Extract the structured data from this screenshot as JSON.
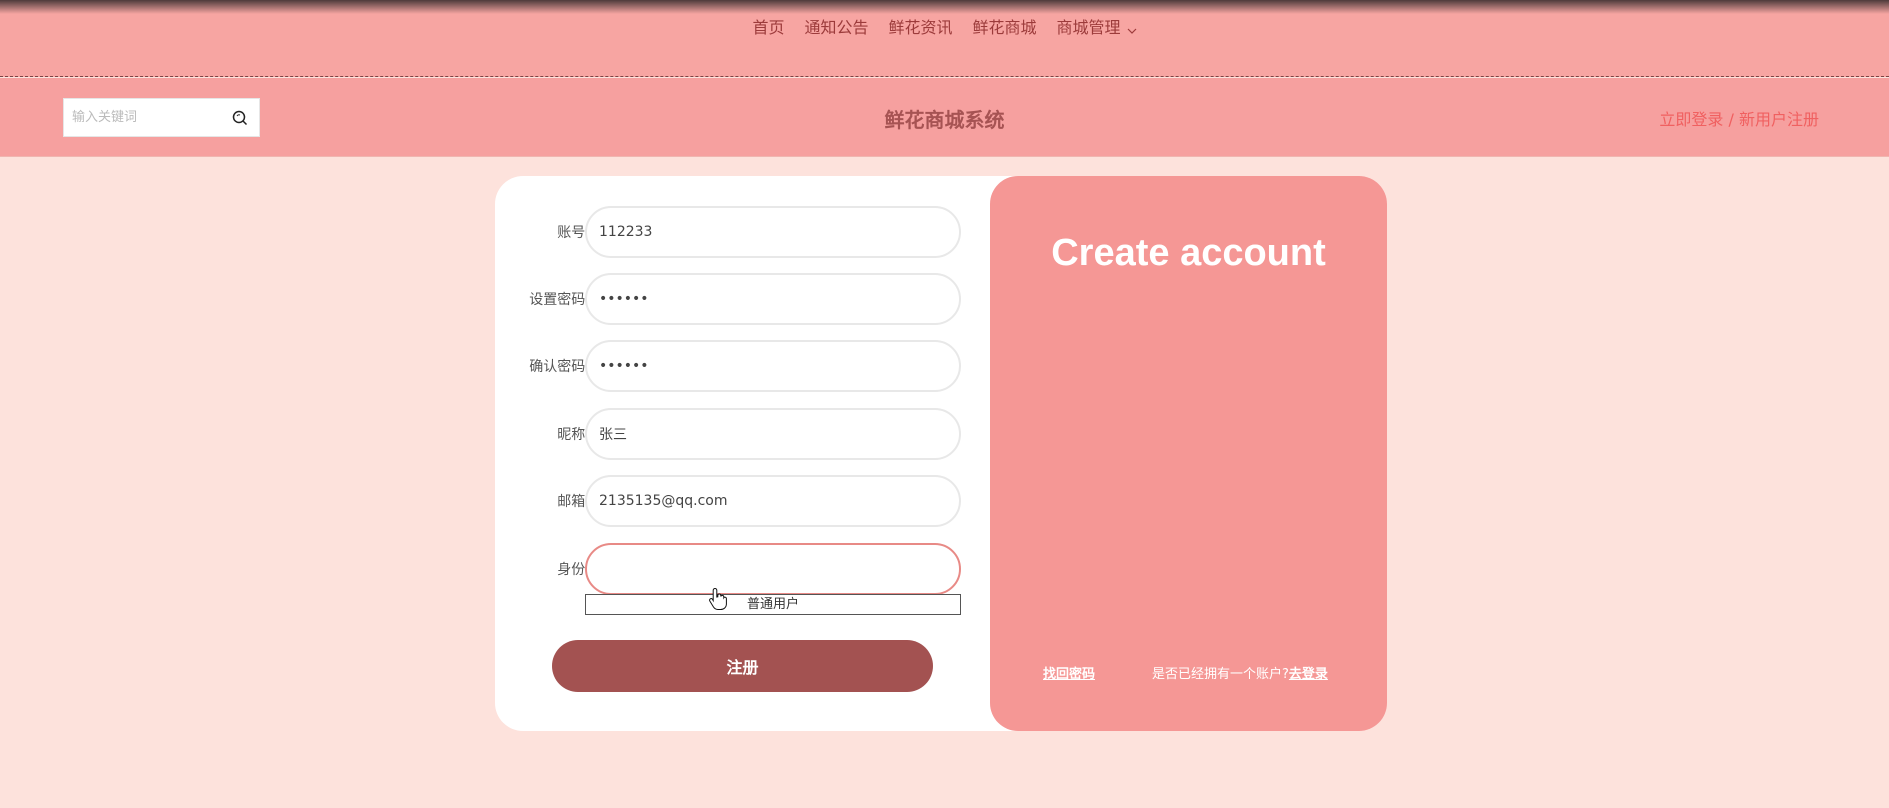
{
  "nav": {
    "items": [
      "首页",
      "通知公告",
      "鲜花资讯",
      "鲜花商城",
      "商城管理"
    ]
  },
  "header": {
    "search_placeholder": "输入关键词",
    "site_title": "鲜花商城系统",
    "login": "立即登录 /",
    "register": "新用户注册"
  },
  "form": {
    "account_label": "账号:",
    "account_value": "112233",
    "password_label": "设置密码:",
    "password_value": "••••••",
    "confirm_label": "确认密码:",
    "confirm_value": "••••••",
    "nickname_label": "昵称:",
    "nickname_value": "张三",
    "email_label": "邮箱:",
    "email_value": "2135135@qq.com",
    "role_label": "身份:",
    "role_value": "",
    "role_option": "普通用户",
    "submit_label": "注册"
  },
  "panel": {
    "title": "Create account",
    "forgot": "找回密码",
    "have_account": "是否已经拥有一个账户?",
    "go_login": "去登录"
  },
  "colors": {
    "topbar": "#f7a5a2",
    "header": "#f6a09f",
    "page_bg": "#fde2dc",
    "panel": "#f59795",
    "submit": "#a35251",
    "title": "#a65353",
    "auth_link": "#f06060"
  }
}
